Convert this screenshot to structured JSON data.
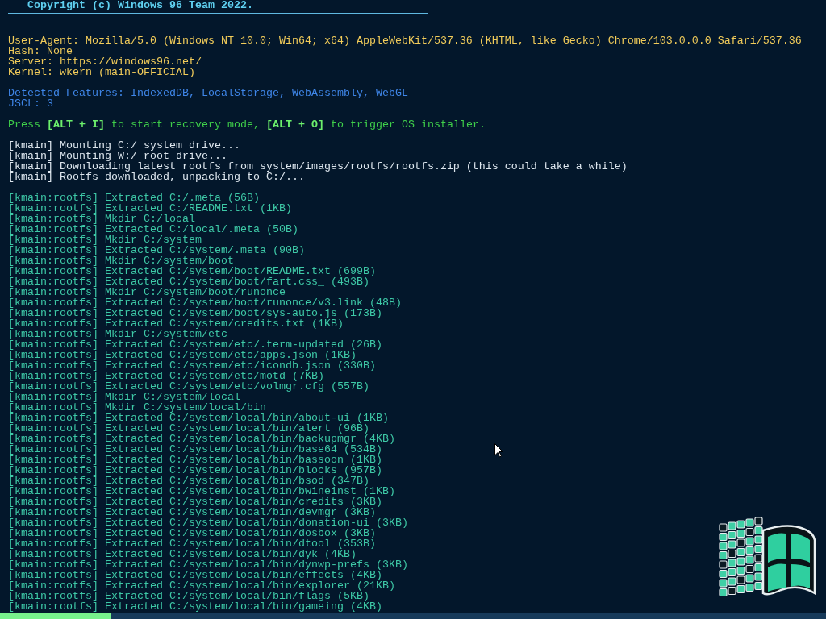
{
  "copyright": "Copyright (c) Windows 96 Team 2022.",
  "system_info": [
    "User-Agent: Mozilla/5.0 (Windows NT 10.0; Win64; x64) AppleWebKit/537.36 (KHTML, like Gecko) Chrome/103.0.0.0 Safari/537.36",
    "Hash: None",
    "Server: https://windows96.net/",
    "Kernel: wkern (main-OFFICIAL)"
  ],
  "features": [
    "Detected Features: IndexedDB, LocalStorage, WebAssembly, WebGL",
    "JSCL: 3"
  ],
  "hint": "Press **[ALT + I]** to start recovery mode, **[ALT + O]** to trigger OS installer.",
  "kernel_log": [
    "[kmain] Mounting C:/ system drive...",
    "[kmain] Mounting W:/ root drive...",
    "[kmain] Downloading latest rootfs from system/images/rootfs/rootfs.zip (this could take a while)",
    "[kmain] Rootfs downloaded, unpacking to C:/..."
  ],
  "rootfs_log": [
    "[kmain:rootfs] Extracted C:/.meta (56B)",
    "[kmain:rootfs] Extracted C:/README.txt (1KB)",
    "[kmain:rootfs] Mkdir C:/local",
    "[kmain:rootfs] Extracted C:/local/.meta (50B)",
    "[kmain:rootfs] Mkdir C:/system",
    "[kmain:rootfs] Extracted C:/system/.meta (90B)",
    "[kmain:rootfs] Mkdir C:/system/boot",
    "[kmain:rootfs] Extracted C:/system/boot/README.txt (699B)",
    "[kmain:rootfs] Extracted C:/system/boot/fart.css_ (493B)",
    "[kmain:rootfs] Mkdir C:/system/boot/runonce",
    "[kmain:rootfs] Extracted C:/system/boot/runonce/v3.link (48B)",
    "[kmain:rootfs] Extracted C:/system/boot/sys-auto.js (173B)",
    "[kmain:rootfs] Extracted C:/system/credits.txt (1KB)",
    "[kmain:rootfs] Mkdir C:/system/etc",
    "[kmain:rootfs] Extracted C:/system/etc/.term-updated (26B)",
    "[kmain:rootfs] Extracted C:/system/etc/apps.json (1KB)",
    "[kmain:rootfs] Extracted C:/system/etc/icondb.json (330B)",
    "[kmain:rootfs] Extracted C:/system/etc/motd (7KB)",
    "[kmain:rootfs] Extracted C:/system/etc/volmgr.cfg (557B)",
    "[kmain:rootfs] Mkdir C:/system/local",
    "[kmain:rootfs] Mkdir C:/system/local/bin",
    "[kmain:rootfs] Extracted C:/system/local/bin/about-ui (1KB)",
    "[kmain:rootfs] Extracted C:/system/local/bin/alert (96B)",
    "[kmain:rootfs] Extracted C:/system/local/bin/backupmgr (4KB)",
    "[kmain:rootfs] Extracted C:/system/local/bin/base64 (534B)",
    "[kmain:rootfs] Extracted C:/system/local/bin/bassoon (1KB)",
    "[kmain:rootfs] Extracted C:/system/local/bin/blocks (957B)",
    "[kmain:rootfs] Extracted C:/system/local/bin/bsod (347B)",
    "[kmain:rootfs] Extracted C:/system/local/bin/bwineinst (1KB)",
    "[kmain:rootfs] Extracted C:/system/local/bin/credits (3KB)",
    "[kmain:rootfs] Extracted C:/system/local/bin/devmgr (3KB)",
    "[kmain:rootfs] Extracted C:/system/local/bin/donation-ui (3KB)",
    "[kmain:rootfs] Extracted C:/system/local/bin/dosbox (3KB)",
    "[kmain:rootfs] Extracted C:/system/local/bin/dtool (353B)",
    "[kmain:rootfs] Extracted C:/system/local/bin/dyk (4KB)",
    "[kmain:rootfs] Extracted C:/system/local/bin/dynwp-prefs (3KB)",
    "[kmain:rootfs] Extracted C:/system/local/bin/effects (4KB)",
    "[kmain:rootfs] Extracted C:/system/local/bin/explorer (21KB)",
    "[kmain:rootfs] Extracted C:/system/local/bin/flags (5KB)",
    "[kmain:rootfs] Extracted C:/system/local/bin/gameing (4KB)"
  ],
  "progress": {
    "level": 0.135
  }
}
